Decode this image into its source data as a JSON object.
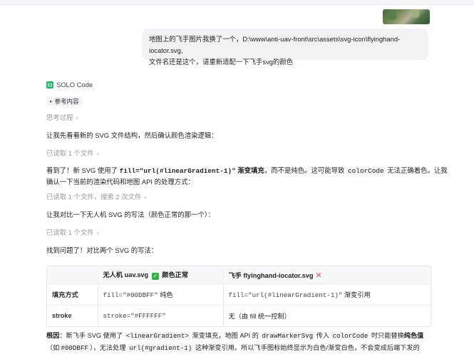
{
  "user_message": {
    "line1": "地图上的飞手图片我换了一个，D:\\www\\anti-uav-front\\src\\assets\\svg-icon\\flyinghand-iocator.svg,",
    "line2": "文件名还是这个，请重新适配一下飞手svg的颜色"
  },
  "assistant": {
    "name": "SOLO Code",
    "reference_label": "参考内容",
    "thinking_label": "思考过程",
    "p1": "让我先看看新的 SVG 文件结构，然后确认颜色渲染逻辑：",
    "step1": "已读取 1 个文件",
    "p2": {
      "a": "看到了！新 SVG 使用了 ",
      "code1": "fill=\"url(#linearGradient-1)\"",
      "b": " 渐变填充",
      "c": "，而不是纯色。这可能导致 ",
      "code2": "colorCode",
      "d": " 无法正确着色。让我",
      "e": "确认一下当前的渲染代码和地图 API 的处理方式："
    },
    "step2": "已读取 1 个文件，搜索 2 次文件",
    "p3": "让我对比一下无人机 SVG 的写法（颜色正常的那一个）：",
    "step3": "已读取 1 个文件",
    "p4": "找到问题了！对比两个 SVG 的写法：",
    "table": {
      "headers": [
        "",
        "无人机 uav.svg",
        "颜色正常",
        "飞手 flyinghand-iocator.svg"
      ],
      "rows": [
        {
          "label": "填充方式",
          "c1_code": "fill=\"#00DBFF\"",
          "c1_text": " 纯色",
          "c2_code": "fill=\"url(#linearGradient-1)\"",
          "c2_text": " 渐变引用"
        },
        {
          "label": "stroke",
          "c1_code": "stroke=\"#FFFFFF\"",
          "c1_text": "",
          "c2_code": "",
          "c2_text": "无（由 fill 统一控制）"
        }
      ]
    },
    "conclusion": {
      "lead": "根因",
      "t1": "：新飞手 SVG 使用了 ",
      "code1": "<linearGradient>",
      "t2": " 渐变填充，地图 API 的 ",
      "code2": "drawMarkerSvg",
      "t3": " 传入 ",
      "code3": "colorCode",
      "t4": " 时只能替换",
      "bold2": "纯色值",
      "t5": "（如",
      "code4": "#00DBFF",
      "t6": "），无法处理 ",
      "code5": "url(#gradient-1)",
      "t7": " 这种渐变引用。所以飞手图标始终显示为白色/渐变白色，不会变成后端下发的"
    }
  },
  "icons": [
    "chevron-right-icon",
    "check-icon",
    "cross-icon",
    "solo-code-icon"
  ],
  "colors": {
    "accent_green": "#1fbf6a",
    "check_green": "#2fb344",
    "cross_red": "#e5484d",
    "bubble_bg": "#f1f2f4"
  }
}
